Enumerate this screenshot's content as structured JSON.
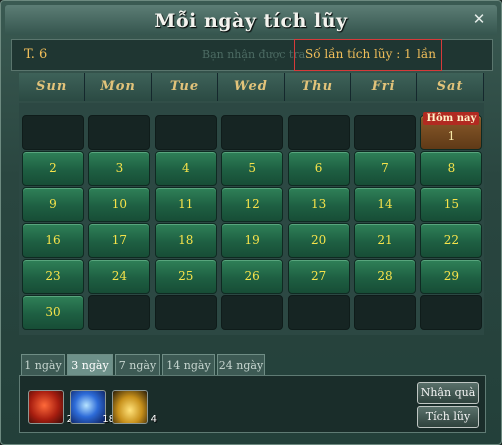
{
  "window": {
    "title": "Mỗi ngày tích lũy",
    "close_glyph": "✕"
  },
  "info": {
    "month_label": "T. 6",
    "ghost_text": "Bạn nhận được tra",
    "accumulated_label": "Số lần tích lũy :",
    "accumulated_value": "1",
    "accumulated_unit": "lần"
  },
  "calendar": {
    "weekdays": [
      "Sun",
      "Mon",
      "Tue",
      "Wed",
      "Thu",
      "Fri",
      "Sat"
    ],
    "today_label": "Hôm nay",
    "rows": [
      [
        "",
        "",
        "",
        "",
        "",
        "",
        "1"
      ],
      [
        "2",
        "3",
        "4",
        "5",
        "6",
        "7",
        "8"
      ],
      [
        "9",
        "10",
        "11",
        "12",
        "13",
        "14",
        "15"
      ],
      [
        "16",
        "17",
        "18",
        "19",
        "20",
        "21",
        "22"
      ],
      [
        "23",
        "24",
        "25",
        "26",
        "27",
        "28",
        "29"
      ],
      [
        "30",
        "",
        "",
        "",
        "",
        "",
        ""
      ]
    ]
  },
  "reward_tabs": [
    "1 ngày",
    "3 ngày",
    "7 ngày",
    "14 ngày",
    "24 ngày"
  ],
  "active_tab": "3 ngày",
  "rewards": [
    {
      "icon": "red-orb-icon",
      "count": "2"
    },
    {
      "icon": "blue-orb-icon",
      "count": "18"
    },
    {
      "icon": "gold-ingot-icon",
      "count": "4"
    }
  ],
  "buttons": {
    "claim": "Nhận quà",
    "accumulate": "Tích lũy"
  }
}
